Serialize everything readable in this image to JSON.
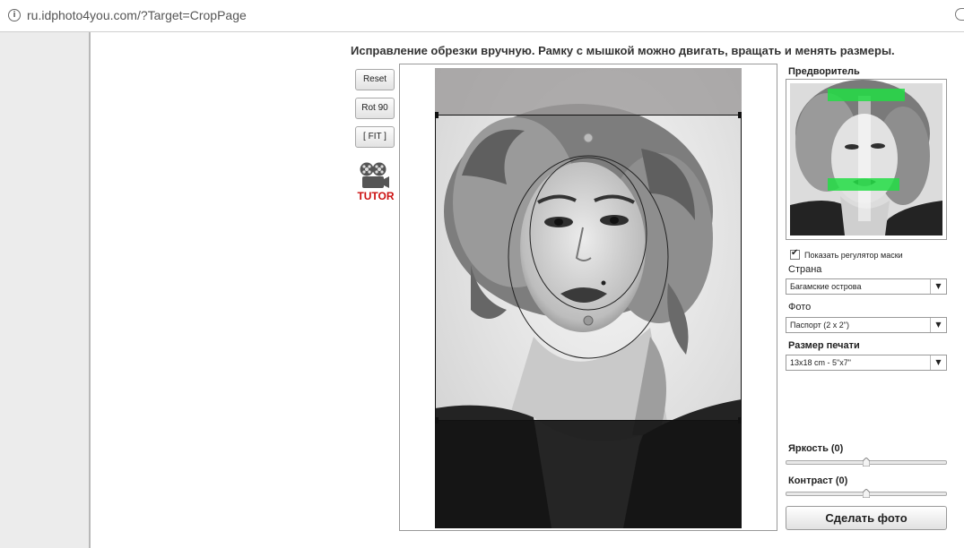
{
  "browser": {
    "url": "ru.idphoto4you.com/?Target=CropPage"
  },
  "heading": "Исправление обрезки вручную. Рамку с мышкой можно двигать, вращать и менять размеры.",
  "tools": {
    "reset_label": "Reset",
    "rot_label": "Rot 90",
    "fit_label": "[ FIT ]",
    "tutor_label": "TUTOR"
  },
  "preview": {
    "title": "Предворитель",
    "show_regulator_label": "Показать регулятор маски",
    "show_regulator_checked": true
  },
  "form": {
    "country_label": "Страна",
    "country_value": "Багамские острова",
    "photo_label": "Фото",
    "photo_value": "Паспорт (2 x 2\")",
    "print_label": "Размер печати",
    "print_value": "13x18 cm - 5\"x7\""
  },
  "adjust": {
    "brightness_label": "Яркость (0)",
    "brightness": 0,
    "contrast_label": "Контраст (0)",
    "contrast": 0
  },
  "make_button_label": "Сделать фото",
  "colors": {
    "tutor_red": "#cc1111",
    "mask_green": "#22dd44"
  },
  "icons": {
    "info": "info-icon",
    "zoom": "zoom-icon",
    "tutor": "film-projector-icon",
    "dropdown": "chevron-down-icon"
  }
}
